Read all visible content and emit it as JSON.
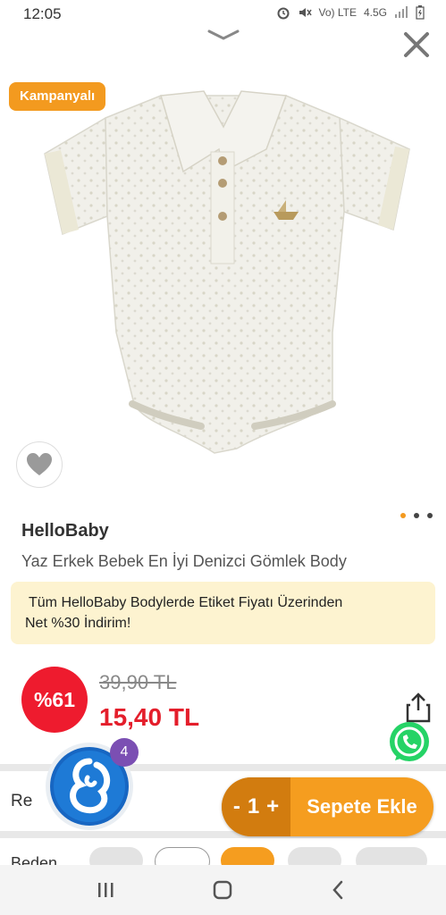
{
  "status": {
    "time": "12:05",
    "network": "Vo) LTE",
    "signal": "4.5G"
  },
  "product": {
    "campaign_badge": "Kampanyalı",
    "brand": "HelloBaby",
    "name": "Yaz Erkek Bebek En İyi Denizci Gömlek Body",
    "promo_line1": "Tüm HelloBaby Bodylerde Etiket Fiyatı Üzerinden",
    "promo_line2": "Net %30 İndirim!",
    "discount_badge": "%61",
    "old_price": "39,90 TL",
    "new_price": "15,40 TL",
    "image_dots": 3,
    "active_dot": 0
  },
  "variant": {
    "color_label": "Re",
    "size_label": "Beden"
  },
  "cart": {
    "minus": "-",
    "quantity": "1",
    "plus": "+",
    "add_label": "Sepete Ekle"
  },
  "assistant": {
    "badge_count": "4"
  },
  "colors": {
    "accent": "#f59d1f",
    "price_red": "#e41e2b",
    "promo_bg": "#fdf3d0"
  }
}
